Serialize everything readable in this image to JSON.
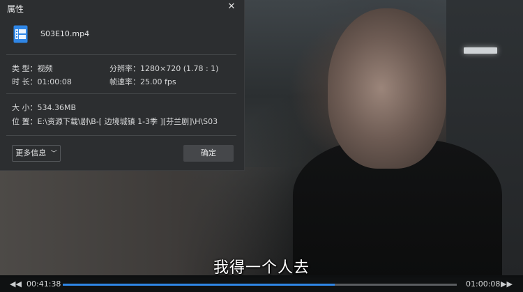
{
  "dialog": {
    "title": "属性",
    "file_name": "S03E10.mp4",
    "type_label": "类 型：",
    "type_value": "视频",
    "resolution_label": "分辨率：",
    "resolution_value": "1280×720 (1.78 : 1)",
    "duration_label": "时 长：",
    "duration_value": "01:00:08",
    "framerate_label": "帧速率：",
    "framerate_value": "25.00 fps",
    "size_label": "大 小：",
    "size_value": "534.36MB",
    "location_label": "位 置：",
    "location_value": "E:\\资源下载\\剧\\B-[ 边境城镇 1-3季 ][芬兰剧]\\H\\S03",
    "more_info_label": "更多信息",
    "ok_label": "确定",
    "close_icon": "close-icon"
  },
  "player": {
    "subtitle": "我得一个人去",
    "current_time": "00:41:38",
    "total_time": "01:00:08",
    "progress": 0.69
  },
  "colors": {
    "accent": "#2f86e6",
    "dialog_bg": "#2c2e30",
    "file_icon": "#2f86e6"
  }
}
